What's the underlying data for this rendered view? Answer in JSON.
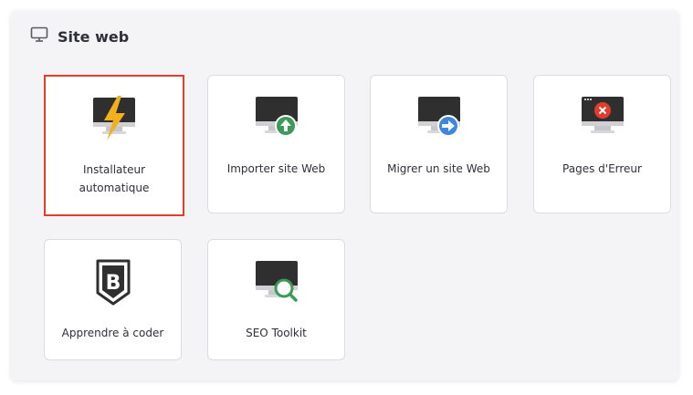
{
  "section": {
    "title": "Site web",
    "icon": "monitor-icon"
  },
  "cards": [
    {
      "label": "Installateur automatique",
      "icon": "auto-installer-icon",
      "selected": true
    },
    {
      "label": "Importer site Web",
      "icon": "import-website-icon",
      "selected": false
    },
    {
      "label": "Migrer un site Web",
      "icon": "migrate-website-icon",
      "selected": false
    },
    {
      "label": "Pages d'Erreur",
      "icon": "error-pages-icon",
      "selected": false
    },
    {
      "label": "Apprendre à coder",
      "icon": "learn-to-code-icon",
      "selected": false
    },
    {
      "label": "SEO Toolkit",
      "icon": "seo-toolkit-icon",
      "selected": false
    }
  ],
  "colors": {
    "highlight": "#e23d2c",
    "import_badge": "#3a9a56",
    "migrate_badge": "#3d87e0",
    "error_badge": "#e23d2c",
    "bolt": "#f2b01d",
    "seo_lens": "#3a9a56"
  }
}
